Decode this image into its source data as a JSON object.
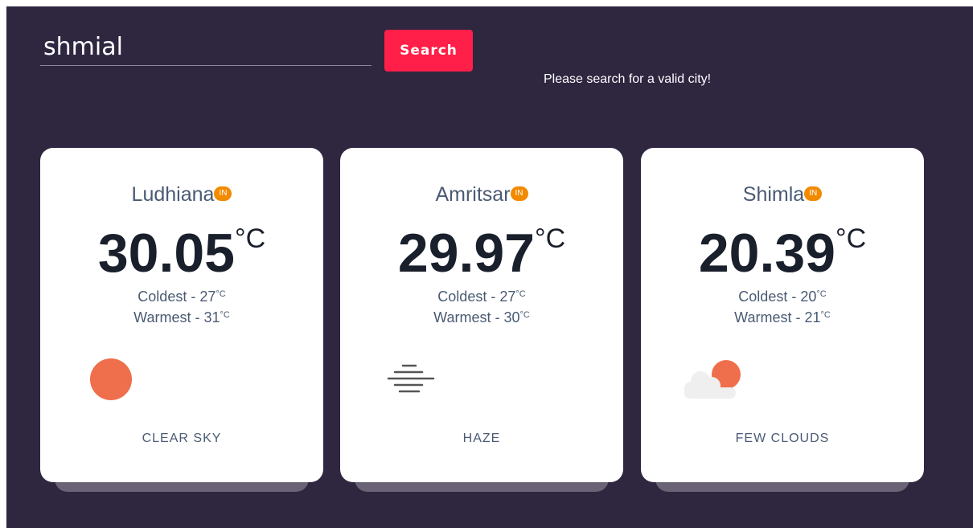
{
  "search": {
    "value": "shmial",
    "placeholder": "",
    "button_label": "Search",
    "error_message": "Please search for a valid city!"
  },
  "cards": [
    {
      "city": "Ludhiana",
      "country": "IN",
      "temp": "30.05",
      "temp_unit": "°C",
      "coldest_label": "Coldest - 27",
      "warmest_label": "Warmest - 31",
      "minmax_unit": "°C",
      "description": "CLEAR SKY",
      "icon": "sun-icon"
    },
    {
      "city": "Amritsar",
      "country": "IN",
      "temp": "29.97",
      "temp_unit": "°C",
      "coldest_label": "Coldest - 27",
      "warmest_label": "Warmest - 30",
      "minmax_unit": "°C",
      "description": "HAZE",
      "icon": "haze-icon"
    },
    {
      "city": "Shimla",
      "country": "IN",
      "temp": "20.39",
      "temp_unit": "°C",
      "coldest_label": "Coldest - 20",
      "warmest_label": "Warmest - 21",
      "minmax_unit": "°C",
      "description": "FEW CLOUDS",
      "icon": "few-clouds-icon"
    }
  ],
  "colors": {
    "background": "#2f2640",
    "accent": "#ff1f48",
    "badge": "#f28a00",
    "sun": "#ef6f4c"
  }
}
